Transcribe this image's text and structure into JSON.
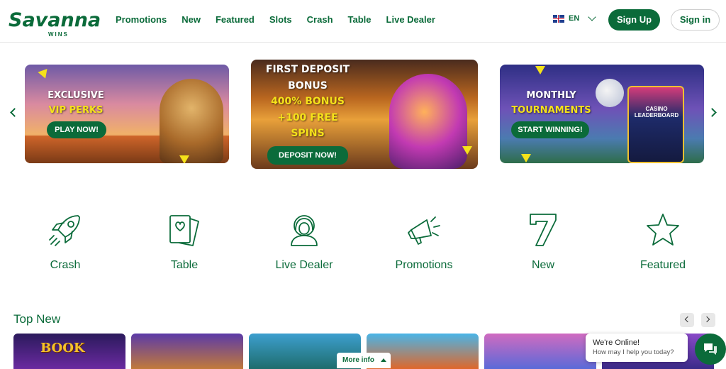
{
  "brand": {
    "logo_main": "Savanna",
    "logo_sub": "WINS"
  },
  "nav": {
    "items": [
      "Promotions",
      "New",
      "Featured",
      "Slots",
      "Crash",
      "Table",
      "Live Dealer"
    ]
  },
  "header": {
    "language": "EN",
    "signup_label": "Sign Up",
    "signin_label": "Sign in"
  },
  "banners": [
    {
      "line1": "EXCLUSIVE",
      "line2": "VIP PERKS",
      "button": "PLAY NOW!"
    },
    {
      "line1": "FIRST DEPOSIT",
      "line2": "BONUS",
      "line3": "400% BONUS",
      "line4": "+100 FREE",
      "line5": "SPINS",
      "button": "DEPOSIT NOW!"
    },
    {
      "line1": "MONTHLY",
      "line2": "TOURNAMENTS",
      "button": "START WINNING!",
      "board_title": "CASINO LEADERBOARD"
    }
  ],
  "categories": [
    {
      "label": "Crash",
      "icon": "rocket-icon"
    },
    {
      "label": "Table",
      "icon": "cards-icon"
    },
    {
      "label": "Live Dealer",
      "icon": "dealer-icon"
    },
    {
      "label": "Promotions",
      "icon": "megaphone-icon"
    },
    {
      "label": "New",
      "icon": "seven-icon"
    },
    {
      "label": "Featured",
      "icon": "star-icon"
    }
  ],
  "top_new": {
    "title": "Top New",
    "first_game_title": "BOOK",
    "more_info": "More info"
  },
  "chat": {
    "title": "We're Online!",
    "subtitle": "How may I help you today?"
  },
  "colors": {
    "brand_green": "#0b6b3a",
    "accent_yellow": "#f5e21a"
  }
}
